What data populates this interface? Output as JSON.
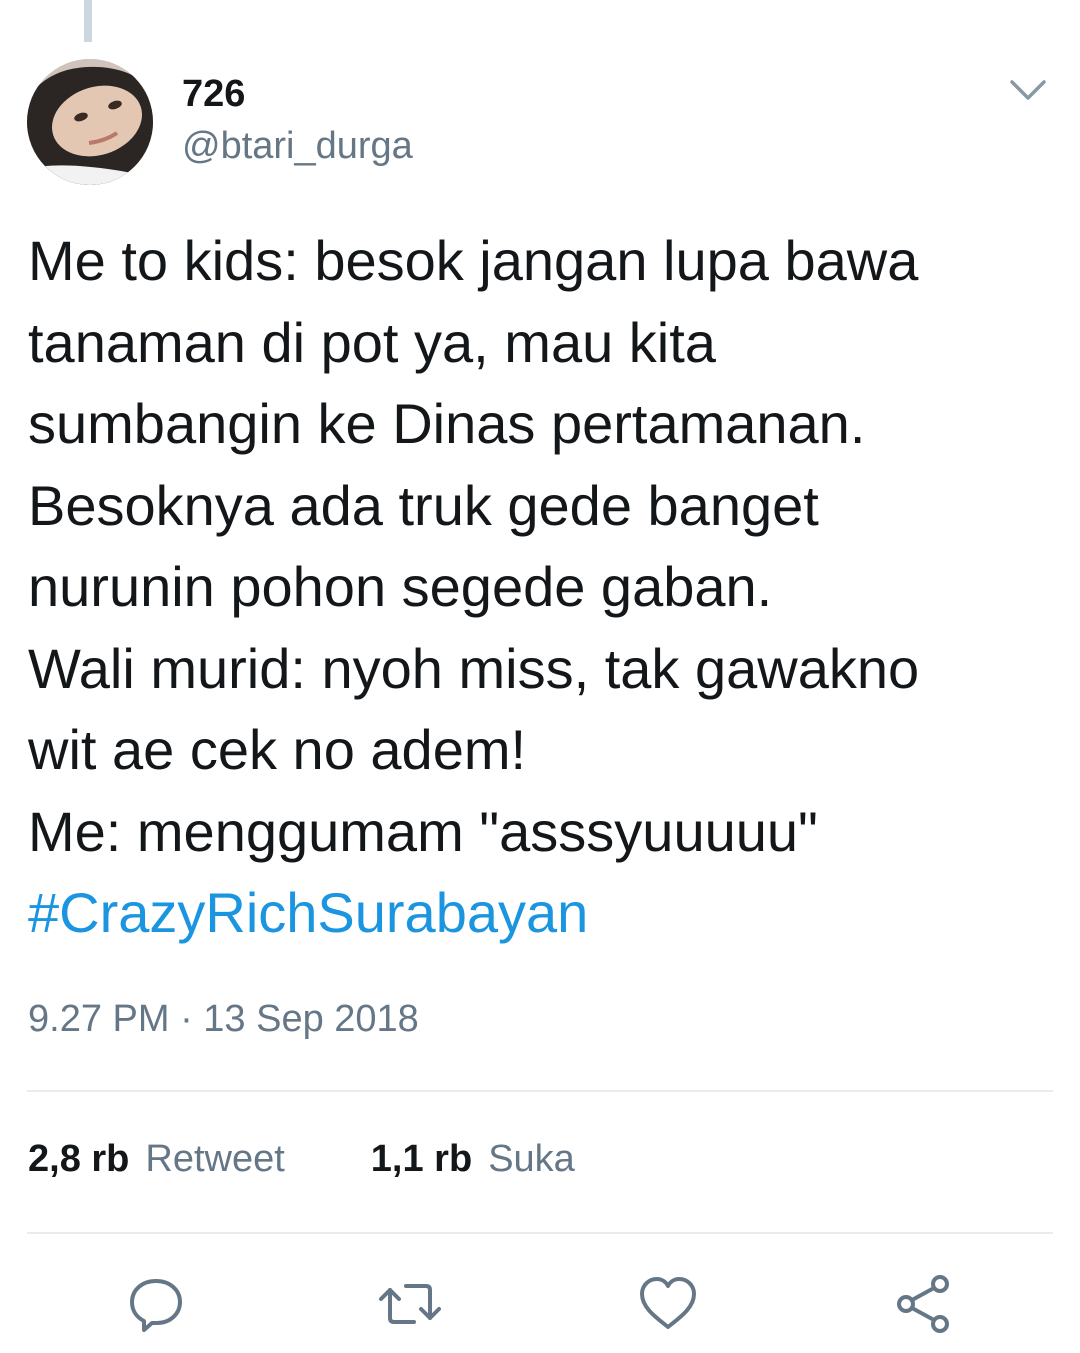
{
  "user": {
    "display_name": "726",
    "handle": "@btari_durga"
  },
  "tweet": {
    "lines": [
      "Me to kids: besok jangan lupa bawa",
      "tanaman di pot ya, mau kita",
      "sumbangin ke Dinas pertamanan.",
      "Besoknya ada truk gede banget",
      "nurunin pohon segede gaban.",
      "Wali murid: nyoh miss, tak gawakno",
      "wit ae cek no adem!",
      "Me: menggumam \"asssyuuuuu\""
    ],
    "hashtag": "#CrazyRichSurabayan",
    "timestamp": "9.27 PM · 13 Sep 2018"
  },
  "stats": {
    "retweets_count": "2,8 rb",
    "retweets_label": "Retweet",
    "likes_count": "1,1 rb",
    "likes_label": "Suka"
  },
  "actions": [
    "reply-icon",
    "retweet-icon",
    "like-icon",
    "share-icon"
  ],
  "colors": {
    "text": "#14171a",
    "secondary": "#657786",
    "link": "#1b95e0",
    "divider": "#e6ecf0",
    "icon": "#657786"
  }
}
